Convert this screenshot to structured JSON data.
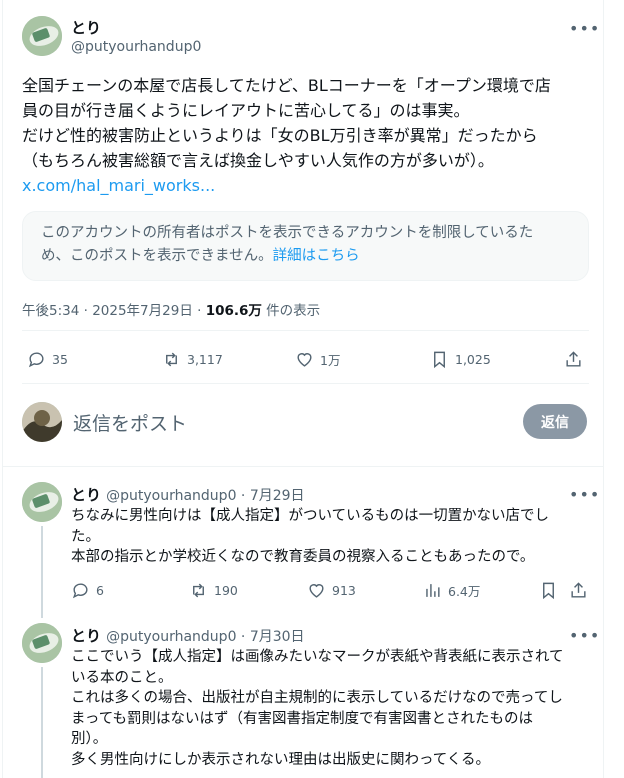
{
  "post": {
    "display_name": "とり",
    "handle": "@putyourhandup0",
    "more": "•••",
    "lines": [
      "全国チェーンの本屋で店長してたけど、BLコーナーを「オープン環境で店",
      "員の目が行き届くようにレイアウトに苦心してる」のは事実。",
      "だけど性的被害防止というよりは「女のBL万引き率が異常」だったから",
      "（もちろん被害総額で言えば換金しやすい人気作の方が多いが）。"
    ],
    "link": "x.com/hal_mari_works...",
    "notice_lines": [
      "このアカウントの所有者はポストを表示できるアカウントを制限しているた",
      "め、このポストを表示できません。"
    ],
    "notice_link": "詳細はこちら",
    "timestamp": "午後5:34 · 2025年7月29日 · ",
    "views": "106.6万",
    "views_suffix": " 件の表示",
    "stats": {
      "replies": "35",
      "reposts": "3,117",
      "likes": "1万",
      "bookmarks": "1,025"
    }
  },
  "composer": {
    "placeholder": "返信をポスト",
    "button": "返信"
  },
  "replies": [
    {
      "display_name": "とり",
      "handle": "@putyourhandup0",
      "date": " · 7月29日",
      "lines": [
        "ちなみに男性向けは【成人指定】がついているものは一切置かない店でし",
        "た。",
        "本部の指示とか学校近くなので教育委員の視察入ることもあったので。"
      ],
      "stats": {
        "replies": "6",
        "reposts": "190",
        "likes": "913",
        "views": "6.4万"
      }
    },
    {
      "display_name": "とり",
      "handle": "@putyourhandup0",
      "date": " · 7月30日",
      "lines": [
        "ここでいう【成人指定】は画像みたいなマークが表紙や背表紙に表示されて",
        "いる本のこと。",
        "これは多くの場合、出版社が自主規制的に表示しているだけなので売ってし",
        "まっても罰則はないはず（有害図書指定制度で有害図書とされたものは",
        "別）。",
        "多く男性向けにしか表示されない理由は出版史に関わってくる。"
      ]
    }
  ]
}
